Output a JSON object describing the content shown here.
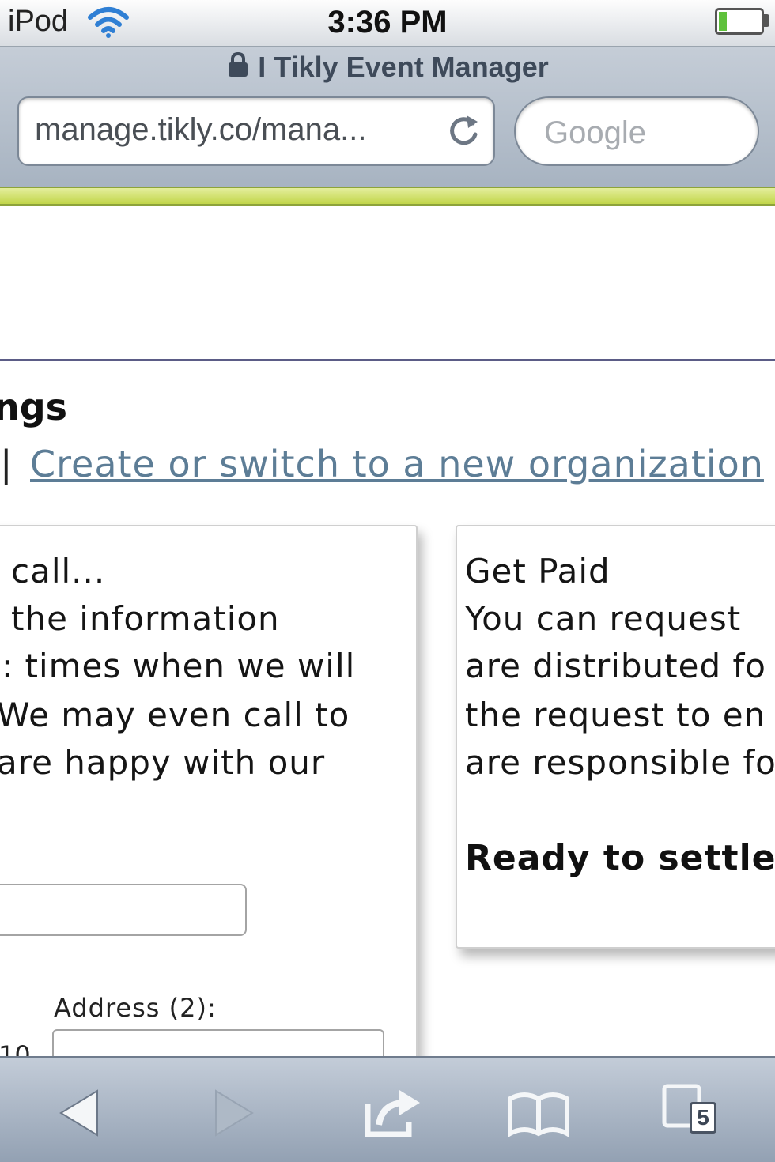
{
  "status_bar": {
    "carrier": "iPod",
    "time": "3:36 PM",
    "battery_level": 0.2
  },
  "browser": {
    "page_title": "I Tikly Event Manager",
    "url": "manage.tikly.co/mana...",
    "search_placeholder": "Google",
    "tab_count": "5"
  },
  "page": {
    "heading_fragment": "ngs",
    "nav_separator": "|",
    "create_org_link": "Create or switch to a new organization"
  },
  "left_panel": {
    "lines": [
      "call...",
      "the information",
      ": times when we will",
      "We may even call to",
      "are happy with our"
    ],
    "address2_label": "Address (2):",
    "zip_fragment": "10"
  },
  "right_panel": {
    "title": "Get Paid",
    "lines": [
      "You can request",
      "are distributed fo",
      "the request to en",
      "are responsible fo"
    ],
    "ready_text": "Ready to settle"
  },
  "colors": {
    "link": "#5d7d96",
    "progress_strip": "#c2d64a",
    "header_rule": "#5b5c86"
  },
  "icons": {
    "wifi": "wifi-icon",
    "lock": "lock-icon",
    "reload": "reload-icon",
    "back": "back-arrow-icon",
    "forward": "forward-arrow-icon",
    "share": "share-icon",
    "bookmarks": "bookmarks-icon",
    "tabs": "tabs-icon"
  }
}
